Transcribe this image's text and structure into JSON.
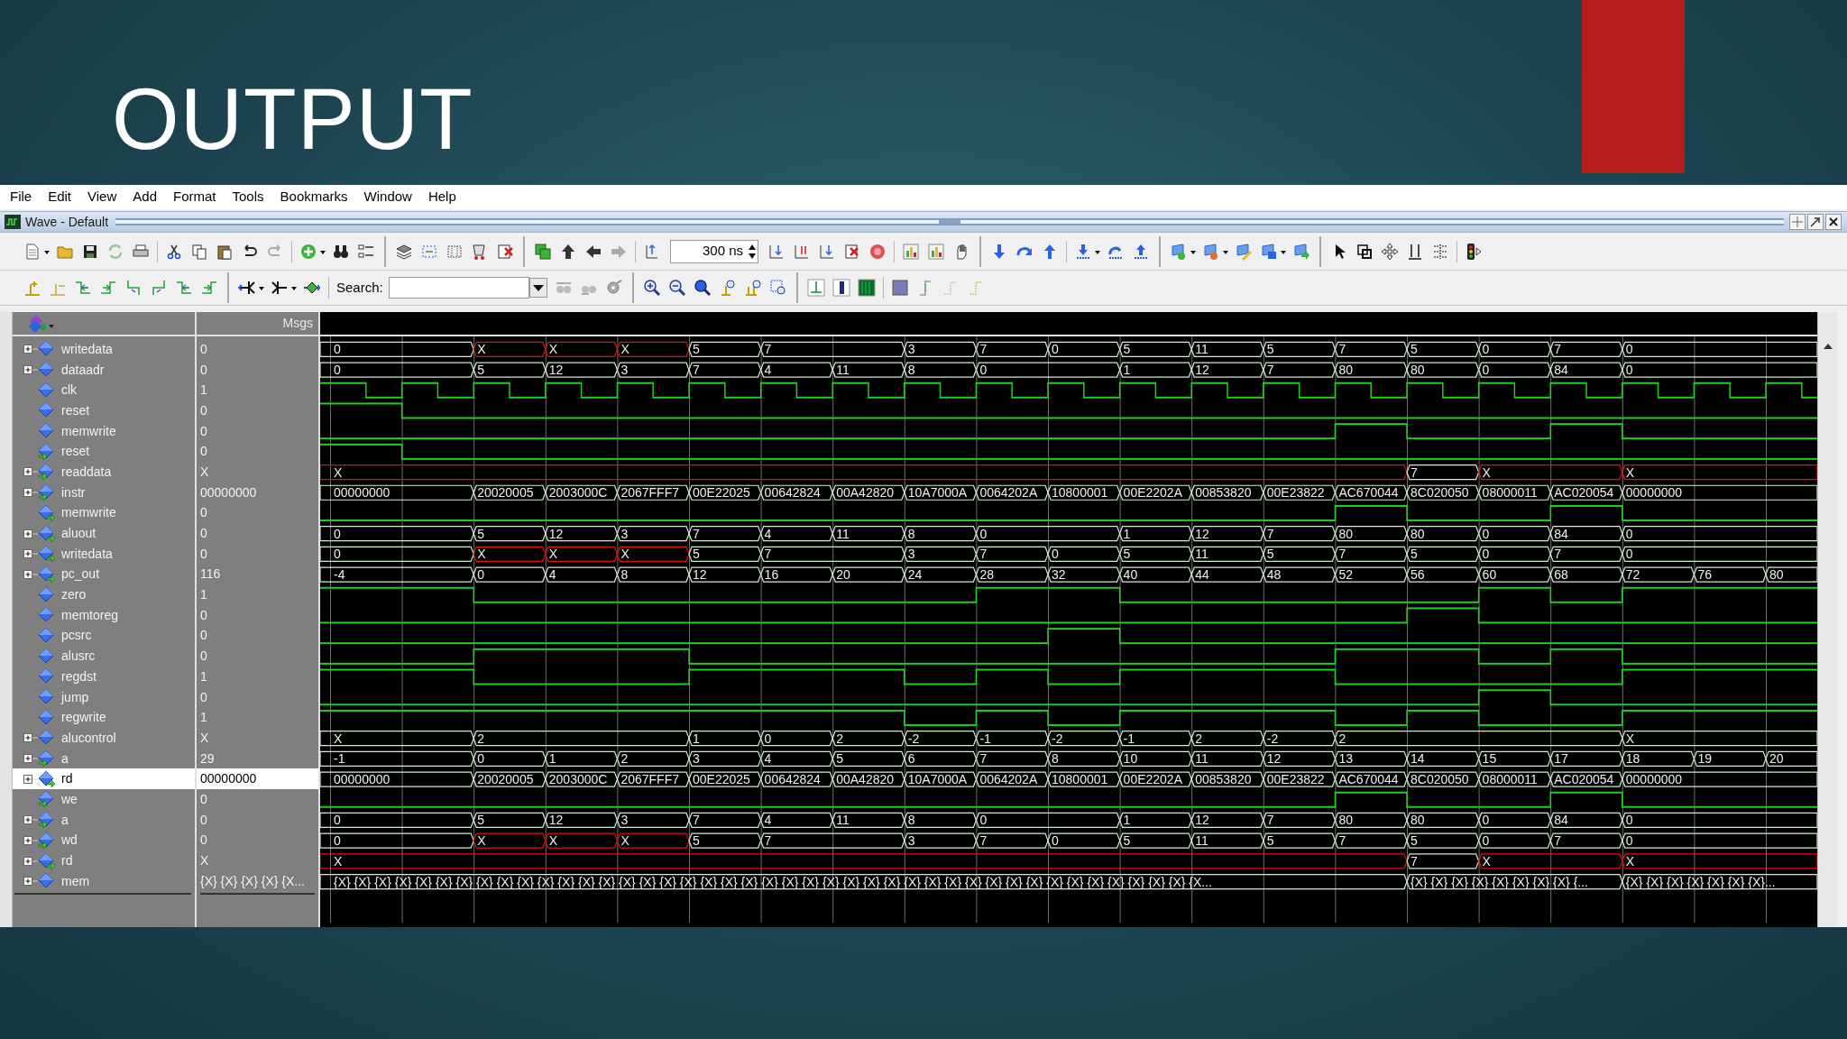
{
  "slide": {
    "title": "OUTPUT"
  },
  "menu": [
    "File",
    "Edit",
    "View",
    "Add",
    "Format",
    "Tools",
    "Bookmarks",
    "Window",
    "Help"
  ],
  "window": {
    "title": "Wave - Default"
  },
  "toolbar": {
    "time_value": "300 ns",
    "search_label": "Search:"
  },
  "wave_panel": {
    "msgs_header": "Msgs"
  },
  "signals": [
    {
      "name": "writedata",
      "kind": "internal",
      "expanded": false,
      "selected": false,
      "value": "0",
      "values": [
        {
          "kind": "change",
          "value": "0",
          "unknown": false
        },
        {
          "kind": "hold"
        },
        {
          "kind": "change",
          "value": "X",
          "unknown": true
        },
        {
          "kind": "change",
          "value": "X",
          "unknown": true
        },
        {
          "kind": "change",
          "value": "X",
          "unknown": true
        },
        {
          "kind": "change",
          "value": "5",
          "unknown": false
        },
        {
          "kind": "change",
          "value": "7",
          "unknown": false
        },
        {
          "kind": "hold"
        },
        {
          "kind": "change",
          "value": "3",
          "unknown": false
        },
        {
          "kind": "change",
          "value": "7",
          "unknown": false
        },
        {
          "kind": "change",
          "value": "0",
          "unknown": false
        },
        {
          "kind": "change",
          "value": "5",
          "unknown": false
        },
        {
          "kind": "change",
          "value": "11",
          "unknown": false
        },
        {
          "kind": "change",
          "value": "5",
          "unknown": false
        },
        {
          "kind": "change",
          "value": "7",
          "unknown": false
        },
        {
          "kind": "change",
          "value": "5",
          "unknown": false
        },
        {
          "kind": "change",
          "value": "0",
          "unknown": false
        },
        {
          "kind": "change",
          "value": "7",
          "unknown": false
        },
        {
          "kind": "change",
          "value": "0",
          "unknown": false
        },
        {
          "kind": "hold"
        },
        {
          "kind": "hold"
        }
      ]
    },
    {
      "name": "dataadr",
      "kind": "internal",
      "expanded": false,
      "selected": false,
      "value": "0",
      "values": [
        {
          "kind": "change",
          "value": "0",
          "unknown": false
        },
        {
          "kind": "hold"
        },
        {
          "kind": "change",
          "value": "5",
          "unknown": false
        },
        {
          "kind": "change",
          "value": "12",
          "unknown": false
        },
        {
          "kind": "change",
          "value": "3",
          "unknown": false
        },
        {
          "kind": "change",
          "value": "7",
          "unknown": false
        },
        {
          "kind": "change",
          "value": "4",
          "unknown": false
        },
        {
          "kind": "change",
          "value": "11",
          "unknown": false
        },
        {
          "kind": "change",
          "value": "8",
          "unknown": false
        },
        {
          "kind": "change",
          "value": "0",
          "unknown": false
        },
        {
          "kind": "hold"
        },
        {
          "kind": "change",
          "value": "1",
          "unknown": false
        },
        {
          "kind": "change",
          "value": "12",
          "unknown": false
        },
        {
          "kind": "change",
          "value": "7",
          "unknown": false
        },
        {
          "kind": "change",
          "value": "80",
          "unknown": false
        },
        {
          "kind": "change",
          "value": "80",
          "unknown": false
        },
        {
          "kind": "change",
          "value": "0",
          "unknown": false
        },
        {
          "kind": "change",
          "value": "84",
          "unknown": false
        },
        {
          "kind": "change",
          "value": "0",
          "unknown": false
        },
        {
          "kind": "hold"
        },
        {
          "kind": "hold"
        }
      ]
    },
    {
      "name": "clk",
      "kind": "internal",
      "selected": false,
      "value": "1",
      "high": [
        true,
        false,
        true,
        false,
        true,
        false,
        true,
        false,
        true,
        false,
        true,
        false,
        true,
        false,
        true,
        false,
        true,
        false,
        true,
        false,
        true,
        false,
        true,
        false,
        true,
        false,
        true,
        false,
        true,
        false,
        true,
        false,
        true,
        false,
        true,
        false,
        true,
        false,
        true,
        false,
        true,
        false
      ]
    },
    {
      "name": "reset",
      "kind": "internal",
      "selected": false,
      "value": "0",
      "high": [
        true,
        false,
        false,
        false,
        false,
        false,
        false,
        false,
        false,
        false,
        false,
        false,
        false,
        false,
        false,
        false,
        false,
        false,
        false,
        false,
        false
      ]
    },
    {
      "name": "memwrite",
      "kind": "internal",
      "selected": false,
      "value": "0",
      "high": [
        false,
        false,
        false,
        false,
        false,
        false,
        false,
        false,
        false,
        false,
        false,
        false,
        false,
        false,
        true,
        false,
        false,
        true,
        false,
        false,
        false
      ]
    },
    {
      "name": "reset",
      "kind": "input",
      "selected": false,
      "value": "0",
      "high": [
        true,
        false,
        false,
        false,
        false,
        false,
        false,
        false,
        false,
        false,
        false,
        false,
        false,
        false,
        false,
        false,
        false,
        false,
        false,
        false,
        false
      ]
    },
    {
      "name": "readdata",
      "kind": "input",
      "expanded": false,
      "selected": false,
      "value": "X",
      "values": [
        {
          "kind": "change",
          "value": "X",
          "unknown": true
        },
        {
          "kind": "hold"
        },
        {
          "kind": "hold"
        },
        {
          "kind": "hold"
        },
        {
          "kind": "hold"
        },
        {
          "kind": "hold"
        },
        {
          "kind": "hold"
        },
        {
          "kind": "hold"
        },
        {
          "kind": "hold"
        },
        {
          "kind": "hold"
        },
        {
          "kind": "hold"
        },
        {
          "kind": "hold"
        },
        {
          "kind": "hold"
        },
        {
          "kind": "hold"
        },
        {
          "kind": "hold"
        },
        {
          "kind": "change",
          "value": "7",
          "unknown": false
        },
        {
          "kind": "change",
          "value": "X",
          "unknown": true
        },
        {
          "kind": "hold"
        },
        {
          "kind": "change",
          "value": "X",
          "unknown": true
        },
        {
          "kind": "hold"
        },
        {
          "kind": "hold"
        }
      ]
    },
    {
      "name": "instr",
      "kind": "input",
      "expanded": false,
      "selected": false,
      "value": "00000000",
      "values": [
        {
          "kind": "change",
          "value": "00000000",
          "unknown": false
        },
        {
          "kind": "hold"
        },
        {
          "kind": "change",
          "value": "20020005",
          "unknown": false
        },
        {
          "kind": "change",
          "value": "2003000C",
          "unknown": false
        },
        {
          "kind": "change",
          "value": "2067FFF7",
          "unknown": false
        },
        {
          "kind": "change",
          "value": "00E22025",
          "unknown": false
        },
        {
          "kind": "change",
          "value": "00642824",
          "unknown": false
        },
        {
          "kind": "change",
          "value": "00A42820",
          "unknown": false
        },
        {
          "kind": "change",
          "value": "10A7000A",
          "unknown": false
        },
        {
          "kind": "change",
          "value": "0064202A",
          "unknown": false
        },
        {
          "kind": "change",
          "value": "10800001",
          "unknown": false
        },
        {
          "kind": "change",
          "value": "00E2202A",
          "unknown": false
        },
        {
          "kind": "change",
          "value": "00853820",
          "unknown": false
        },
        {
          "kind": "change",
          "value": "00E23822",
          "unknown": false
        },
        {
          "kind": "change",
          "value": "AC670044",
          "unknown": false
        },
        {
          "kind": "change",
          "value": "8C020050",
          "unknown": false
        },
        {
          "kind": "change",
          "value": "08000011",
          "unknown": false
        },
        {
          "kind": "change",
          "value": "AC020054",
          "unknown": false
        },
        {
          "kind": "change",
          "value": "00000000",
          "unknown": false
        },
        {
          "kind": "hold"
        },
        {
          "kind": "hold"
        }
      ]
    },
    {
      "name": "memwrite",
      "kind": "output",
      "selected": false,
      "value": "0",
      "high": [
        false,
        false,
        false,
        false,
        false,
        false,
        false,
        false,
        false,
        false,
        false,
        false,
        false,
        false,
        true,
        false,
        false,
        true,
        false,
        false,
        false
      ]
    },
    {
      "name": "aluout",
      "kind": "output",
      "expanded": false,
      "selected": false,
      "value": "0",
      "values": [
        {
          "kind": "change",
          "value": "0",
          "unknown": false
        },
        {
          "kind": "hold"
        },
        {
          "kind": "change",
          "value": "5",
          "unknown": false
        },
        {
          "kind": "change",
          "value": "12",
          "unknown": false
        },
        {
          "kind": "change",
          "value": "3",
          "unknown": false
        },
        {
          "kind": "change",
          "value": "7",
          "unknown": false
        },
        {
          "kind": "change",
          "value": "4",
          "unknown": false
        },
        {
          "kind": "change",
          "value": "11",
          "unknown": false
        },
        {
          "kind": "change",
          "value": "8",
          "unknown": false
        },
        {
          "kind": "change",
          "value": "0",
          "unknown": false
        },
        {
          "kind": "hold"
        },
        {
          "kind": "change",
          "value": "1",
          "unknown": false
        },
        {
          "kind": "change",
          "value": "12",
          "unknown": false
        },
        {
          "kind": "change",
          "value": "7",
          "unknown": false
        },
        {
          "kind": "change",
          "value": "80",
          "unknown": false
        },
        {
          "kind": "change",
          "value": "80",
          "unknown": false
        },
        {
          "kind": "change",
          "value": "0",
          "unknown": false
        },
        {
          "kind": "change",
          "value": "84",
          "unknown": false
        },
        {
          "kind": "change",
          "value": "0",
          "unknown": false
        },
        {
          "kind": "hold"
        },
        {
          "kind": "hold"
        }
      ]
    },
    {
      "name": "writedata",
      "kind": "output",
      "expanded": false,
      "selected": false,
      "value": "0",
      "values": [
        {
          "kind": "change",
          "value": "0",
          "unknown": false
        },
        {
          "kind": "hold"
        },
        {
          "kind": "change",
          "value": "X",
          "unknown": true
        },
        {
          "kind": "change",
          "value": "X",
          "unknown": true
        },
        {
          "kind": "change",
          "value": "X",
          "unknown": true
        },
        {
          "kind": "change",
          "value": "5",
          "unknown": false
        },
        {
          "kind": "change",
          "value": "7",
          "unknown": false
        },
        {
          "kind": "hold"
        },
        {
          "kind": "change",
          "value": "3",
          "unknown": false
        },
        {
          "kind": "change",
          "value": "7",
          "unknown": false
        },
        {
          "kind": "change",
          "value": "0",
          "unknown": false
        },
        {
          "kind": "change",
          "value": "5",
          "unknown": false
        },
        {
          "kind": "change",
          "value": "11",
          "unknown": false
        },
        {
          "kind": "change",
          "value": "5",
          "unknown": false
        },
        {
          "kind": "change",
          "value": "7",
          "unknown": false
        },
        {
          "kind": "change",
          "value": "5",
          "unknown": false
        },
        {
          "kind": "change",
          "value": "0",
          "unknown": false
        },
        {
          "kind": "change",
          "value": "7",
          "unknown": false
        },
        {
          "kind": "change",
          "value": "0",
          "unknown": false
        },
        {
          "kind": "hold"
        },
        {
          "kind": "hold"
        }
      ]
    },
    {
      "name": "pc_out",
      "kind": "output",
      "expanded": false,
      "selected": false,
      "value": "116",
      "values": [
        {
          "kind": "change",
          "value": "-4",
          "unknown": false
        },
        {
          "kind": "hold"
        },
        {
          "kind": "change",
          "value": "0",
          "unknown": false
        },
        {
          "kind": "change",
          "value": "4",
          "unknown": false
        },
        {
          "kind": "change",
          "value": "8",
          "unknown": false
        },
        {
          "kind": "change",
          "value": "12",
          "unknown": false
        },
        {
          "kind": "change",
          "value": "16",
          "unknown": false
        },
        {
          "kind": "change",
          "value": "20",
          "unknown": false
        },
        {
          "kind": "change",
          "value": "24",
          "unknown": false
        },
        {
          "kind": "change",
          "value": "28",
          "unknown": false
        },
        {
          "kind": "change",
          "value": "32",
          "unknown": false
        },
        {
          "kind": "change",
          "value": "40",
          "unknown": false
        },
        {
          "kind": "change",
          "value": "44",
          "unknown": false
        },
        {
          "kind": "change",
          "value": "48",
          "unknown": false
        },
        {
          "kind": "change",
          "value": "52",
          "unknown": false
        },
        {
          "kind": "change",
          "value": "56",
          "unknown": false
        },
        {
          "kind": "change",
          "value": "60",
          "unknown": false
        },
        {
          "kind": "change",
          "value": "68",
          "unknown": false
        },
        {
          "kind": "change",
          "value": "72",
          "unknown": false
        },
        {
          "kind": "change",
          "value": "76",
          "unknown": false
        },
        {
          "kind": "change",
          "value": "80",
          "unknown": false
        }
      ]
    },
    {
      "name": "zero",
      "kind": "internal",
      "selected": false,
      "value": "1",
      "high": [
        true,
        true,
        false,
        false,
        false,
        false,
        false,
        false,
        false,
        true,
        true,
        false,
        false,
        false,
        false,
        false,
        true,
        false,
        true,
        true,
        true
      ]
    },
    {
      "name": "memtoreg",
      "kind": "internal",
      "selected": false,
      "value": "0",
      "high": [
        false,
        false,
        false,
        false,
        false,
        false,
        false,
        false,
        false,
        false,
        false,
        false,
        false,
        false,
        false,
        true,
        false,
        false,
        false,
        false,
        false
      ]
    },
    {
      "name": "pcsrc",
      "kind": "internal",
      "selected": false,
      "value": "0",
      "high": [
        false,
        false,
        false,
        false,
        false,
        false,
        false,
        false,
        false,
        false,
        true,
        false,
        false,
        false,
        false,
        false,
        false,
        false,
        false,
        false,
        false
      ]
    },
    {
      "name": "alusrc",
      "kind": "internal",
      "selected": false,
      "value": "0",
      "high": [
        false,
        false,
        true,
        true,
        true,
        false,
        false,
        false,
        false,
        false,
        false,
        false,
        false,
        false,
        true,
        true,
        false,
        true,
        false,
        false,
        false
      ]
    },
    {
      "name": "regdst",
      "kind": "internal",
      "selected": false,
      "value": "1",
      "high": [
        true,
        true,
        false,
        false,
        false,
        true,
        true,
        true,
        false,
        true,
        false,
        true,
        true,
        true,
        false,
        false,
        false,
        false,
        true,
        true,
        true
      ]
    },
    {
      "name": "jump",
      "kind": "internal",
      "selected": false,
      "value": "0",
      "high": [
        false,
        false,
        false,
        false,
        false,
        false,
        false,
        false,
        false,
        false,
        false,
        false,
        false,
        false,
        false,
        false,
        true,
        false,
        false,
        false,
        false
      ]
    },
    {
      "name": "regwrite",
      "kind": "internal",
      "selected": false,
      "value": "1",
      "high": [
        true,
        true,
        true,
        true,
        true,
        true,
        true,
        true,
        false,
        true,
        false,
        true,
        true,
        true,
        false,
        true,
        false,
        false,
        true,
        true,
        true
      ]
    },
    {
      "name": "alucontrol",
      "kind": "internal",
      "expanded": false,
      "selected": false,
      "value": "X",
      "values": [
        {
          "kind": "change",
          "value": "X",
          "unknown": false
        },
        {
          "kind": "hold"
        },
        {
          "kind": "change",
          "value": "2",
          "unknown": false
        },
        {
          "kind": "hold"
        },
        {
          "kind": "hold"
        },
        {
          "kind": "change",
          "value": "1",
          "unknown": false
        },
        {
          "kind": "change",
          "value": "0",
          "unknown": false
        },
        {
          "kind": "change",
          "value": "2",
          "unknown": false
        },
        {
          "kind": "change",
          "value": "-2",
          "unknown": false
        },
        {
          "kind": "change",
          "value": "-1",
          "unknown": false
        },
        {
          "kind": "change",
          "value": "-2",
          "unknown": false
        },
        {
          "kind": "change",
          "value": "-1",
          "unknown": false
        },
        {
          "kind": "change",
          "value": "2",
          "unknown": false
        },
        {
          "kind": "change",
          "value": "-2",
          "unknown": false
        },
        {
          "kind": "change",
          "value": "2",
          "unknown": false
        },
        {
          "kind": "hold"
        },
        {
          "kind": "hold"
        },
        {
          "kind": "hold"
        },
        {
          "kind": "change",
          "value": "X",
          "unknown": false
        },
        {
          "kind": "hold"
        },
        {
          "kind": "hold"
        }
      ]
    },
    {
      "name": "a",
      "kind": "input",
      "expanded": false,
      "selected": false,
      "value": "29",
      "values": [
        {
          "kind": "change",
          "value": "-1",
          "unknown": false
        },
        {
          "kind": "hold"
        },
        {
          "kind": "change",
          "value": "0",
          "unknown": false
        },
        {
          "kind": "change",
          "value": "1",
          "unknown": false
        },
        {
          "kind": "change",
          "value": "2",
          "unknown": false
        },
        {
          "kind": "change",
          "value": "3",
          "unknown": false
        },
        {
          "kind": "change",
          "value": "4",
          "unknown": false
        },
        {
          "kind": "change",
          "value": "5",
          "unknown": false
        },
        {
          "kind": "change",
          "value": "6",
          "unknown": false
        },
        {
          "kind": "change",
          "value": "7",
          "unknown": false
        },
        {
          "kind": "change",
          "value": "8",
          "unknown": false
        },
        {
          "kind": "change",
          "value": "10",
          "unknown": false
        },
        {
          "kind": "change",
          "value": "11",
          "unknown": false
        },
        {
          "kind": "change",
          "value": "12",
          "unknown": false
        },
        {
          "kind": "change",
          "value": "13",
          "unknown": false
        },
        {
          "kind": "change",
          "value": "14",
          "unknown": false
        },
        {
          "kind": "change",
          "value": "15",
          "unknown": false
        },
        {
          "kind": "change",
          "value": "17",
          "unknown": false
        },
        {
          "kind": "change",
          "value": "18",
          "unknown": false
        },
        {
          "kind": "change",
          "value": "19",
          "unknown": false
        },
        {
          "kind": "change",
          "value": "20",
          "unknown": false
        }
      ]
    },
    {
      "name": "rd",
      "kind": "output",
      "expanded": false,
      "selected": true,
      "value": "00000000",
      "values": [
        {
          "kind": "change",
          "value": "00000000",
          "unknown": false
        },
        {
          "kind": "hold"
        },
        {
          "kind": "change",
          "value": "20020005",
          "unknown": false
        },
        {
          "kind": "change",
          "value": "2003000C",
          "unknown": false
        },
        {
          "kind": "change",
          "value": "2067FFF7",
          "unknown": false
        },
        {
          "kind": "change",
          "value": "00E22025",
          "unknown": false
        },
        {
          "kind": "change",
          "value": "00642824",
          "unknown": false
        },
        {
          "kind": "change",
          "value": "00A42820",
          "unknown": false
        },
        {
          "kind": "change",
          "value": "10A7000A",
          "unknown": false
        },
        {
          "kind": "change",
          "value": "0064202A",
          "unknown": false
        },
        {
          "kind": "change",
          "value": "10800001",
          "unknown": false
        },
        {
          "kind": "change",
          "value": "00E2202A",
          "unknown": false
        },
        {
          "kind": "change",
          "value": "00853820",
          "unknown": false
        },
        {
          "kind": "change",
          "value": "00E23822",
          "unknown": false
        },
        {
          "kind": "change",
          "value": "AC670044",
          "unknown": false
        },
        {
          "kind": "change",
          "value": "8C020050",
          "unknown": false
        },
        {
          "kind": "change",
          "value": "08000011",
          "unknown": false
        },
        {
          "kind": "change",
          "value": "AC020054",
          "unknown": false
        },
        {
          "kind": "change",
          "value": "00000000",
          "unknown": false
        },
        {
          "kind": "hold"
        },
        {
          "kind": "hold"
        }
      ]
    },
    {
      "name": "we",
      "kind": "input",
      "selected": false,
      "value": "0",
      "high": [
        false,
        false,
        false,
        false,
        false,
        false,
        false,
        false,
        false,
        false,
        false,
        false,
        false,
        false,
        true,
        false,
        false,
        true,
        false,
        false,
        false
      ]
    },
    {
      "name": "a",
      "kind": "input",
      "expanded": false,
      "selected": false,
      "value": "0",
      "values": [
        {
          "kind": "change",
          "value": "0",
          "unknown": false
        },
        {
          "kind": "hold"
        },
        {
          "kind": "change",
          "value": "5",
          "unknown": false
        },
        {
          "kind": "change",
          "value": "12",
          "unknown": false
        },
        {
          "kind": "change",
          "value": "3",
          "unknown": false
        },
        {
          "kind": "change",
          "value": "7",
          "unknown": false
        },
        {
          "kind": "change",
          "value": "4",
          "unknown": false
        },
        {
          "kind": "change",
          "value": "11",
          "unknown": false
        },
        {
          "kind": "change",
          "value": "8",
          "unknown": false
        },
        {
          "kind": "change",
          "value": "0",
          "unknown": false
        },
        {
          "kind": "hold"
        },
        {
          "kind": "change",
          "value": "1",
          "unknown": false
        },
        {
          "kind": "change",
          "value": "12",
          "unknown": false
        },
        {
          "kind": "change",
          "value": "7",
          "unknown": false
        },
        {
          "kind": "change",
          "value": "80",
          "unknown": false
        },
        {
          "kind": "change",
          "value": "80",
          "unknown": false
        },
        {
          "kind": "change",
          "value": "0",
          "unknown": false
        },
        {
          "kind": "change",
          "value": "84",
          "unknown": false
        },
        {
          "kind": "change",
          "value": "0",
          "unknown": false
        },
        {
          "kind": "hold"
        },
        {
          "kind": "hold"
        }
      ]
    },
    {
      "name": "wd",
      "kind": "input",
      "expanded": false,
      "selected": false,
      "value": "0",
      "values": [
        {
          "kind": "change",
          "value": "0",
          "unknown": false
        },
        {
          "kind": "hold"
        },
        {
          "kind": "change",
          "value": "X",
          "unknown": true
        },
        {
          "kind": "change",
          "value": "X",
          "unknown": true
        },
        {
          "kind": "change",
          "value": "X",
          "unknown": true
        },
        {
          "kind": "change",
          "value": "5",
          "unknown": false
        },
        {
          "kind": "change",
          "value": "7",
          "unknown": false
        },
        {
          "kind": "hold"
        },
        {
          "kind": "change",
          "value": "3",
          "unknown": false
        },
        {
          "kind": "change",
          "value": "7",
          "unknown": false
        },
        {
          "kind": "change",
          "value": "0",
          "unknown": false
        },
        {
          "kind": "change",
          "value": "5",
          "unknown": false
        },
        {
          "kind": "change",
          "value": "11",
          "unknown": false
        },
        {
          "kind": "change",
          "value": "5",
          "unknown": false
        },
        {
          "kind": "change",
          "value": "7",
          "unknown": false
        },
        {
          "kind": "change",
          "value": "5",
          "unknown": false
        },
        {
          "kind": "change",
          "value": "0",
          "unknown": false
        },
        {
          "kind": "change",
          "value": "7",
          "unknown": false
        },
        {
          "kind": "change",
          "value": "0",
          "unknown": false
        },
        {
          "kind": "hold"
        },
        {
          "kind": "hold"
        }
      ]
    },
    {
      "name": "rd",
      "kind": "output",
      "expanded": false,
      "selected": false,
      "value": "X",
      "values": [
        {
          "kind": "change",
          "value": "X",
          "unknown": true
        },
        {
          "kind": "hold"
        },
        {
          "kind": "hold"
        },
        {
          "kind": "hold"
        },
        {
          "kind": "hold"
        },
        {
          "kind": "hold"
        },
        {
          "kind": "hold"
        },
        {
          "kind": "hold"
        },
        {
          "kind": "hold"
        },
        {
          "kind": "hold"
        },
        {
          "kind": "hold"
        },
        {
          "kind": "hold"
        },
        {
          "kind": "hold"
        },
        {
          "kind": "hold"
        },
        {
          "kind": "hold"
        },
        {
          "kind": "change",
          "value": "7",
          "unknown": false
        },
        {
          "kind": "change",
          "value": "X",
          "unknown": true
        },
        {
          "kind": "hold"
        },
        {
          "kind": "change",
          "value": "X",
          "unknown": true
        },
        {
          "kind": "hold"
        },
        {
          "kind": "hold"
        }
      ]
    },
    {
      "name": "mem",
      "kind": "internal",
      "expanded": false,
      "selected": false,
      "value": "{X} {X} {X} {X} {X...",
      "values": [
        {
          "kind": "change",
          "value": "{X} {X} {X} {X} {X} {X} {X} {X} {X} {X} {X} {X} {X} {X} {X} {X} {X} {X} {X} {X} {X} {X} {X} {X} {X} {X} {X} {X} {X} {X} {X} {X} {X} {X} {X} {X} {X} {X} {X} {X} {X} {X} {X...",
          "unknown": false
        },
        {
          "kind": "hold"
        },
        {
          "kind": "hold"
        },
        {
          "kind": "hold"
        },
        {
          "kind": "hold"
        },
        {
          "kind": "hold"
        },
        {
          "kind": "hold"
        },
        {
          "kind": "hold"
        },
        {
          "kind": "hold"
        },
        {
          "kind": "hold"
        },
        {
          "kind": "hold"
        },
        {
          "kind": "hold"
        },
        {
          "kind": "hold"
        },
        {
          "kind": "hold"
        },
        {
          "kind": "hold"
        },
        {
          "kind": "change",
          "value": "{X} {X} {X} {X} {X} {X} {X} {X} {...",
          "unknown": false
        },
        {
          "kind": "hold"
        },
        {
          "kind": "hold"
        },
        {
          "kind": "change",
          "value": "{X} {X} {X} {X} {X} {X} {X}...",
          "unknown": false
        },
        {
          "kind": "hold"
        },
        {
          "kind": "hold"
        }
      ]
    }
  ]
}
